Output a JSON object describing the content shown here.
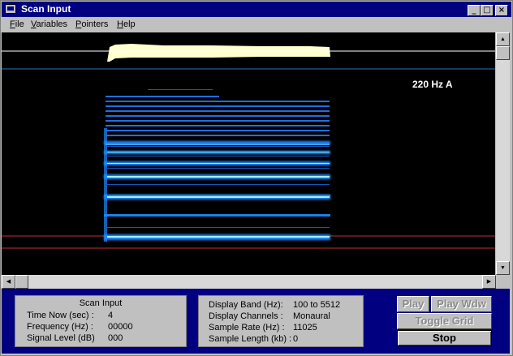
{
  "window": {
    "title": "Scan Input"
  },
  "title_buttons": {
    "minimize": "_",
    "maximize": "□",
    "close": "×"
  },
  "menu": [
    {
      "label": "File",
      "accel": "F",
      "rest": "ile"
    },
    {
      "label": "Variables",
      "accel": "V",
      "rest": "ariables"
    },
    {
      "label": "Pointers",
      "accel": "P",
      "rest": "ointers"
    },
    {
      "label": "Help",
      "accel": "H",
      "rest": "elp"
    }
  ],
  "display": {
    "note_label": "220 Hz  A",
    "colors": {
      "background": "#000000",
      "waveform": "#ffffd0",
      "marker_white": "#ffffff",
      "marker_blue": "#2f6fc0",
      "marker_red": "#c03030",
      "harmonic": "#1a8aff",
      "harmonic_core": "#a0f0ff"
    }
  },
  "scrollbars": {
    "up": "▲",
    "down": "▼",
    "left": "◀",
    "right": "▶"
  },
  "scan_panel": {
    "title": "Scan Input",
    "rows": [
      {
        "label": "Time Now (sec) :",
        "value": "4"
      },
      {
        "label": "Frequency (Hz) :",
        "value": "00000"
      },
      {
        "label": "Signal Level (dB)",
        "value": "000"
      }
    ]
  },
  "display_panel": {
    "rows": [
      {
        "label": "Display Band (Hz):",
        "value": "100 to 5512"
      },
      {
        "label": "Display Channels :",
        "value": "Monaural"
      },
      {
        "label": "Sample Rate (Hz) :",
        "value": "11025"
      },
      {
        "label": "Sample Length (kb) :",
        "value": "0"
      }
    ]
  },
  "controls": {
    "play": "Play",
    "play_wdw": "Play Wdw",
    "toggle_grid": "Toggle Grid",
    "stop": "Stop"
  }
}
